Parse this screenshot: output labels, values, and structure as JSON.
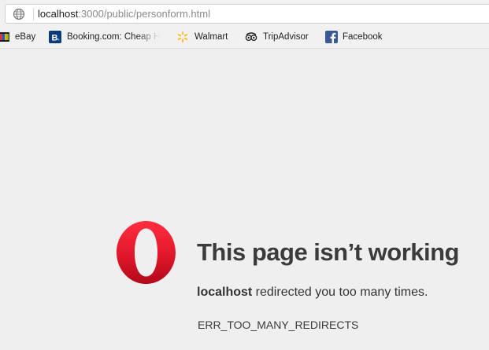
{
  "address_bar": {
    "host": "localhost",
    "path": ":3000/public/personform.html"
  },
  "bookmarks": [
    {
      "label": "eBay",
      "icon": "ebay-icon"
    },
    {
      "label": "Booking.com: Cheap H",
      "icon": "booking-icon"
    },
    {
      "label": "Walmart",
      "icon": "walmart-icon"
    },
    {
      "label": "TripAdvisor",
      "icon": "tripadvisor-icon"
    },
    {
      "label": "Facebook",
      "icon": "facebook-icon"
    }
  ],
  "error": {
    "title": "This page isn’t working",
    "host": "localhost",
    "message": " redirected you too many times.",
    "code": "ERR_TOO_MANY_REDIRECTS"
  },
  "colors": {
    "page_background": "#efefef",
    "opera_red": "#e0172a",
    "booking_blue": "#0c3b7c",
    "walmart_yellow": "#fdbb30",
    "facebook_blue": "#3b5998"
  }
}
